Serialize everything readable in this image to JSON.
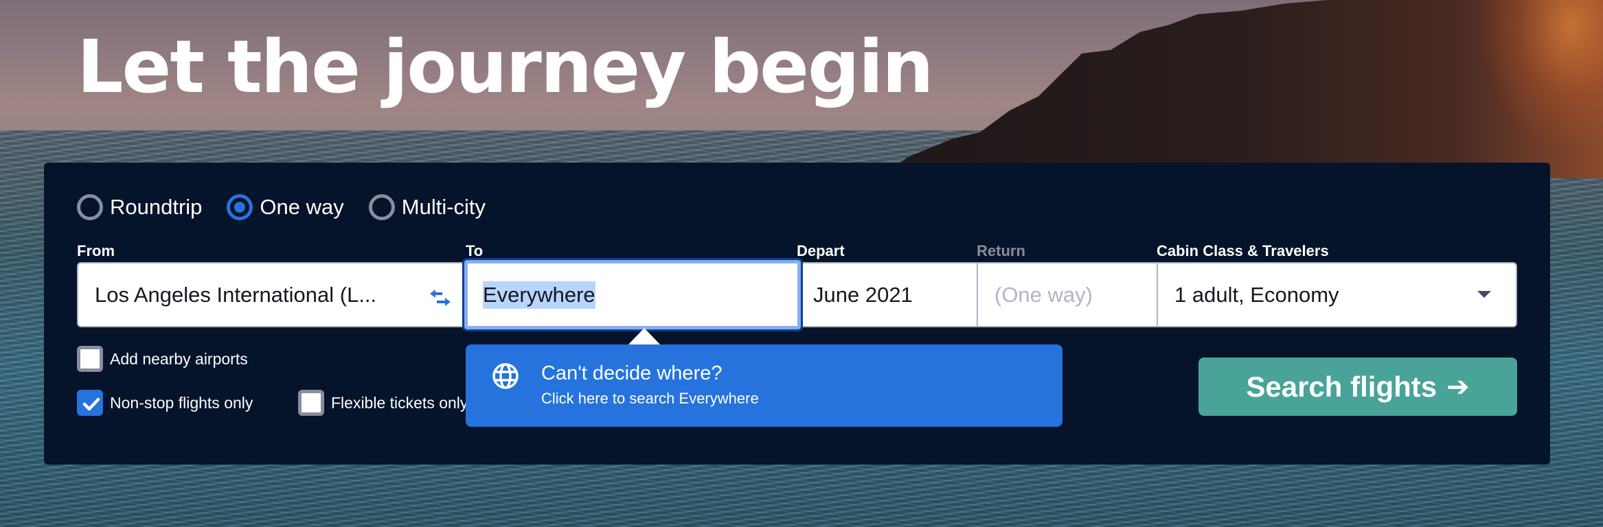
{
  "hero": {
    "title": "Let the journey begin"
  },
  "trip_types": [
    {
      "label": "Roundtrip",
      "checked": false
    },
    {
      "label": "One way",
      "checked": true
    },
    {
      "label": "Multi-city",
      "checked": false
    }
  ],
  "fields": {
    "from": {
      "label": "From",
      "value": "Los Angeles International (L..."
    },
    "to": {
      "label": "To",
      "value": "Everywhere"
    },
    "depart": {
      "label": "Depart",
      "value": "June 2021"
    },
    "return": {
      "label": "Return",
      "placeholder": "(One way)"
    },
    "cabin": {
      "label": "Cabin Class & Travelers",
      "value": "1 adult, Economy"
    }
  },
  "options": {
    "nearby": {
      "label": "Add nearby airports",
      "checked": false
    },
    "nonstop": {
      "label": "Non-stop flights only",
      "checked": true
    },
    "flexible": {
      "label": "Flexible tickets only",
      "checked": false
    }
  },
  "tooltip": {
    "icon": "globe-icon",
    "title": "Can't decide where?",
    "subtitle": "Click here to search Everywhere"
  },
  "search_button": {
    "label": "Search flights",
    "icon": "arrow-right-icon"
  },
  "colors": {
    "panel": "#05132b",
    "accent": "#2673dd",
    "search_button": "#49a398"
  }
}
